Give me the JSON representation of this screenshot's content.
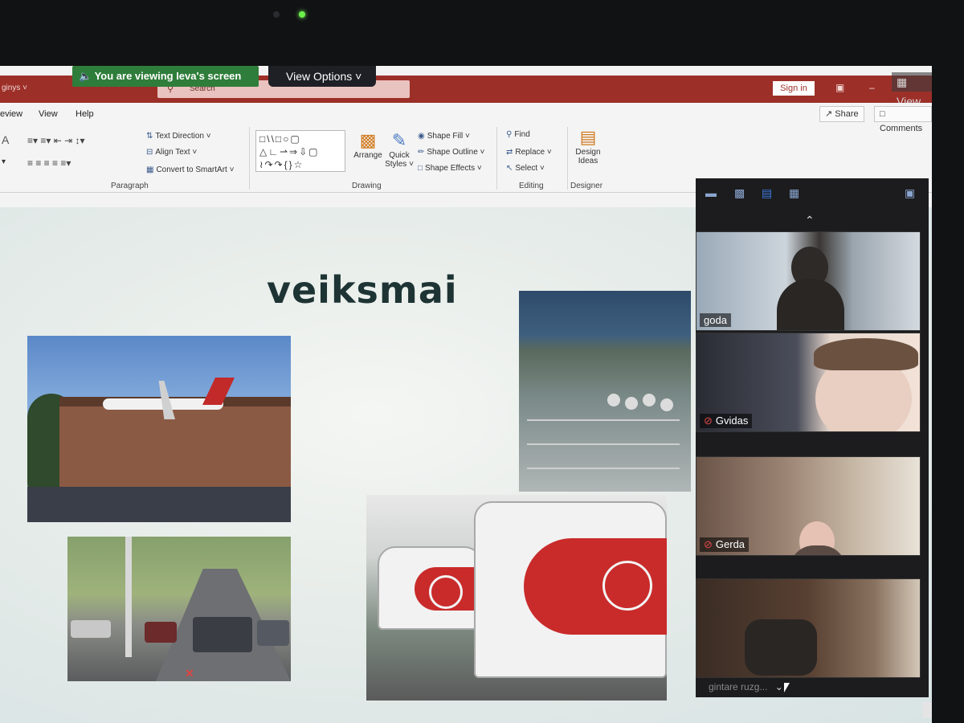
{
  "screen_share": {
    "viewing_banner": "You are viewing Ieva's screen",
    "view_options": "View Options ˅",
    "view_button": "View"
  },
  "titlebar": {
    "doc_name_fragment": "ginys ˅",
    "search_placeholder": "Search",
    "sign_in": "Sign in"
  },
  "ribbon": {
    "tabs": [
      "eview",
      "View",
      "Help"
    ],
    "share": "Share",
    "comments": "Comments",
    "paragraph": {
      "text_direction": "Text Direction ˅",
      "align_text": "Align Text ˅",
      "convert_smartart": "Convert to SmartArt ˅",
      "label": "Paragraph"
    },
    "drawing": {
      "arrange": "Arrange",
      "quick_styles": "Quick Styles ˅",
      "shape_fill": "Shape Fill ˅",
      "shape_outline": "Shape Outline ˅",
      "shape_effects": "Shape Effects ˅",
      "label": "Drawing"
    },
    "editing": {
      "find": "Find",
      "replace": "Replace ˅",
      "select": "Select ˅",
      "label": "Editing"
    },
    "designer": {
      "design_ideas": "Design Ideas",
      "label": "Designer"
    }
  },
  "slide": {
    "title": "veiksmai"
  },
  "gallery": {
    "participants": [
      {
        "name": "goda",
        "muted": false
      },
      {
        "name": "Gvidas",
        "muted": true
      },
      {
        "name": "Gerda",
        "muted": true
      },
      {
        "name": "gintare ruzg...",
        "muted": false
      }
    ]
  },
  "colors": {
    "titlebar": "#9c2f28",
    "share_banner": "#2f7d3a",
    "gallery_bg": "#1c1c1e"
  }
}
